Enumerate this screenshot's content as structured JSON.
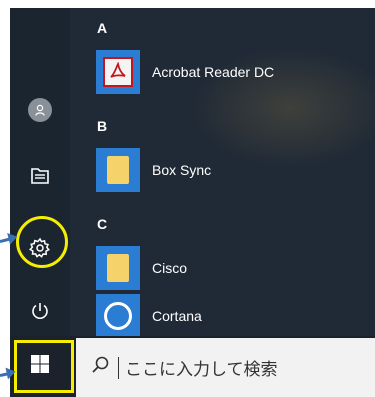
{
  "start_menu": {
    "rail": {
      "user_icon": "user-avatar-icon",
      "documents_icon": "documents-icon",
      "settings_icon": "gear-icon",
      "power_icon": "power-icon"
    },
    "groups": [
      {
        "letter": "A",
        "apps": [
          {
            "name": "Acrobat Reader DC",
            "icon": "acrobat-icon",
            "tile_color": "#2b7cd3"
          }
        ]
      },
      {
        "letter": "B",
        "apps": [
          {
            "name": "Box Sync",
            "icon": "folder-icon",
            "tile_color": "#2b7cd3"
          }
        ]
      },
      {
        "letter": "C",
        "apps": [
          {
            "name": "Cisco",
            "icon": "folder-icon",
            "tile_color": "#2b7cd3"
          },
          {
            "name": "Cortana",
            "icon": "cortana-ring-icon",
            "tile_color": "#2b7cd3"
          }
        ]
      }
    ]
  },
  "taskbar": {
    "start_icon": "windows-logo-icon",
    "search": {
      "icon": "search-icon",
      "placeholder": "ここに入力して検索"
    }
  },
  "colors": {
    "highlight": "#f5ee00",
    "arrow": "#3a6fb0",
    "accent_tile": "#2b7cd3",
    "folder": "#f5d36a",
    "acrobat_red": "#c4161c"
  }
}
